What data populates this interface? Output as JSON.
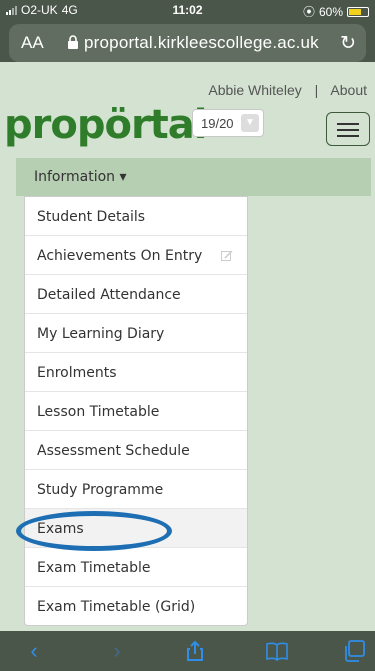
{
  "status_bar": {
    "carrier": "O2-UK",
    "network": "4G",
    "time": "11:02",
    "battery": "60%",
    "alarm": "⦿"
  },
  "browser": {
    "text_size_control": "AA",
    "url": "proportal.kirkleescollege.ac.uk"
  },
  "header": {
    "user_name": "Abbie Whiteley",
    "separator": "|",
    "about_link": "About",
    "logo": "propörtal",
    "year_select": "19/20"
  },
  "nav": {
    "dropdown_label": "Information ▾"
  },
  "menu": {
    "items": [
      {
        "label": "Student Details"
      },
      {
        "label": "Achievements On Entry"
      },
      {
        "label": "Detailed Attendance"
      },
      {
        "label": "My Learning Diary"
      },
      {
        "label": "Enrolments"
      },
      {
        "label": "Lesson Timetable"
      },
      {
        "label": "Assessment Schedule"
      },
      {
        "label": "Study Programme"
      },
      {
        "label": "Exams"
      },
      {
        "label": "Exam Timetable"
      },
      {
        "label": "Exam Timetable (Grid)"
      }
    ]
  },
  "colors": {
    "brand_green": "#2f7d2a",
    "highlight_circle": "#1d6eb3",
    "ios_blue": "#2f8ee8"
  }
}
